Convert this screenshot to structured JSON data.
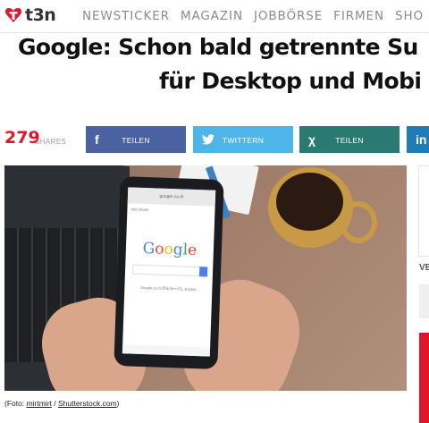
{
  "nav": {
    "logo": "t3n",
    "items": [
      "NEWSTICKER",
      "MAGAZIN",
      "JOBBÖRSE",
      "FIRMEN",
      "SHO"
    ]
  },
  "article": {
    "title_line1": "Google: Schon bald getrennte Su",
    "title_line2": "für Desktop und Mobi"
  },
  "share": {
    "count": "279",
    "count_label": "SHARES",
    "facebook_label": "TEILEN",
    "twitter_label": "TWITTERN",
    "xing_label": "TEILEN",
    "linkedin_label": "in"
  },
  "photo": {
    "phone_url": "google.co.th",
    "phone_logo": "Google",
    "phone_text": "Google.co.th ที่ให้บริการใน: English",
    "phone_tabs": "Alle   Bilder"
  },
  "caption": {
    "prefix": "(Foto: ",
    "author": "mirtmirt",
    "sep": " / ",
    "source": "Shutterstock.com",
    "suffix": ")"
  },
  "sidebar": {
    "label": "VE"
  },
  "colors": {
    "brand_red": "#e0162b",
    "facebook": "#4a62a0",
    "twitter": "#4fb5e8",
    "xing": "#2b7a72",
    "linkedin": "#1f7bb6"
  }
}
